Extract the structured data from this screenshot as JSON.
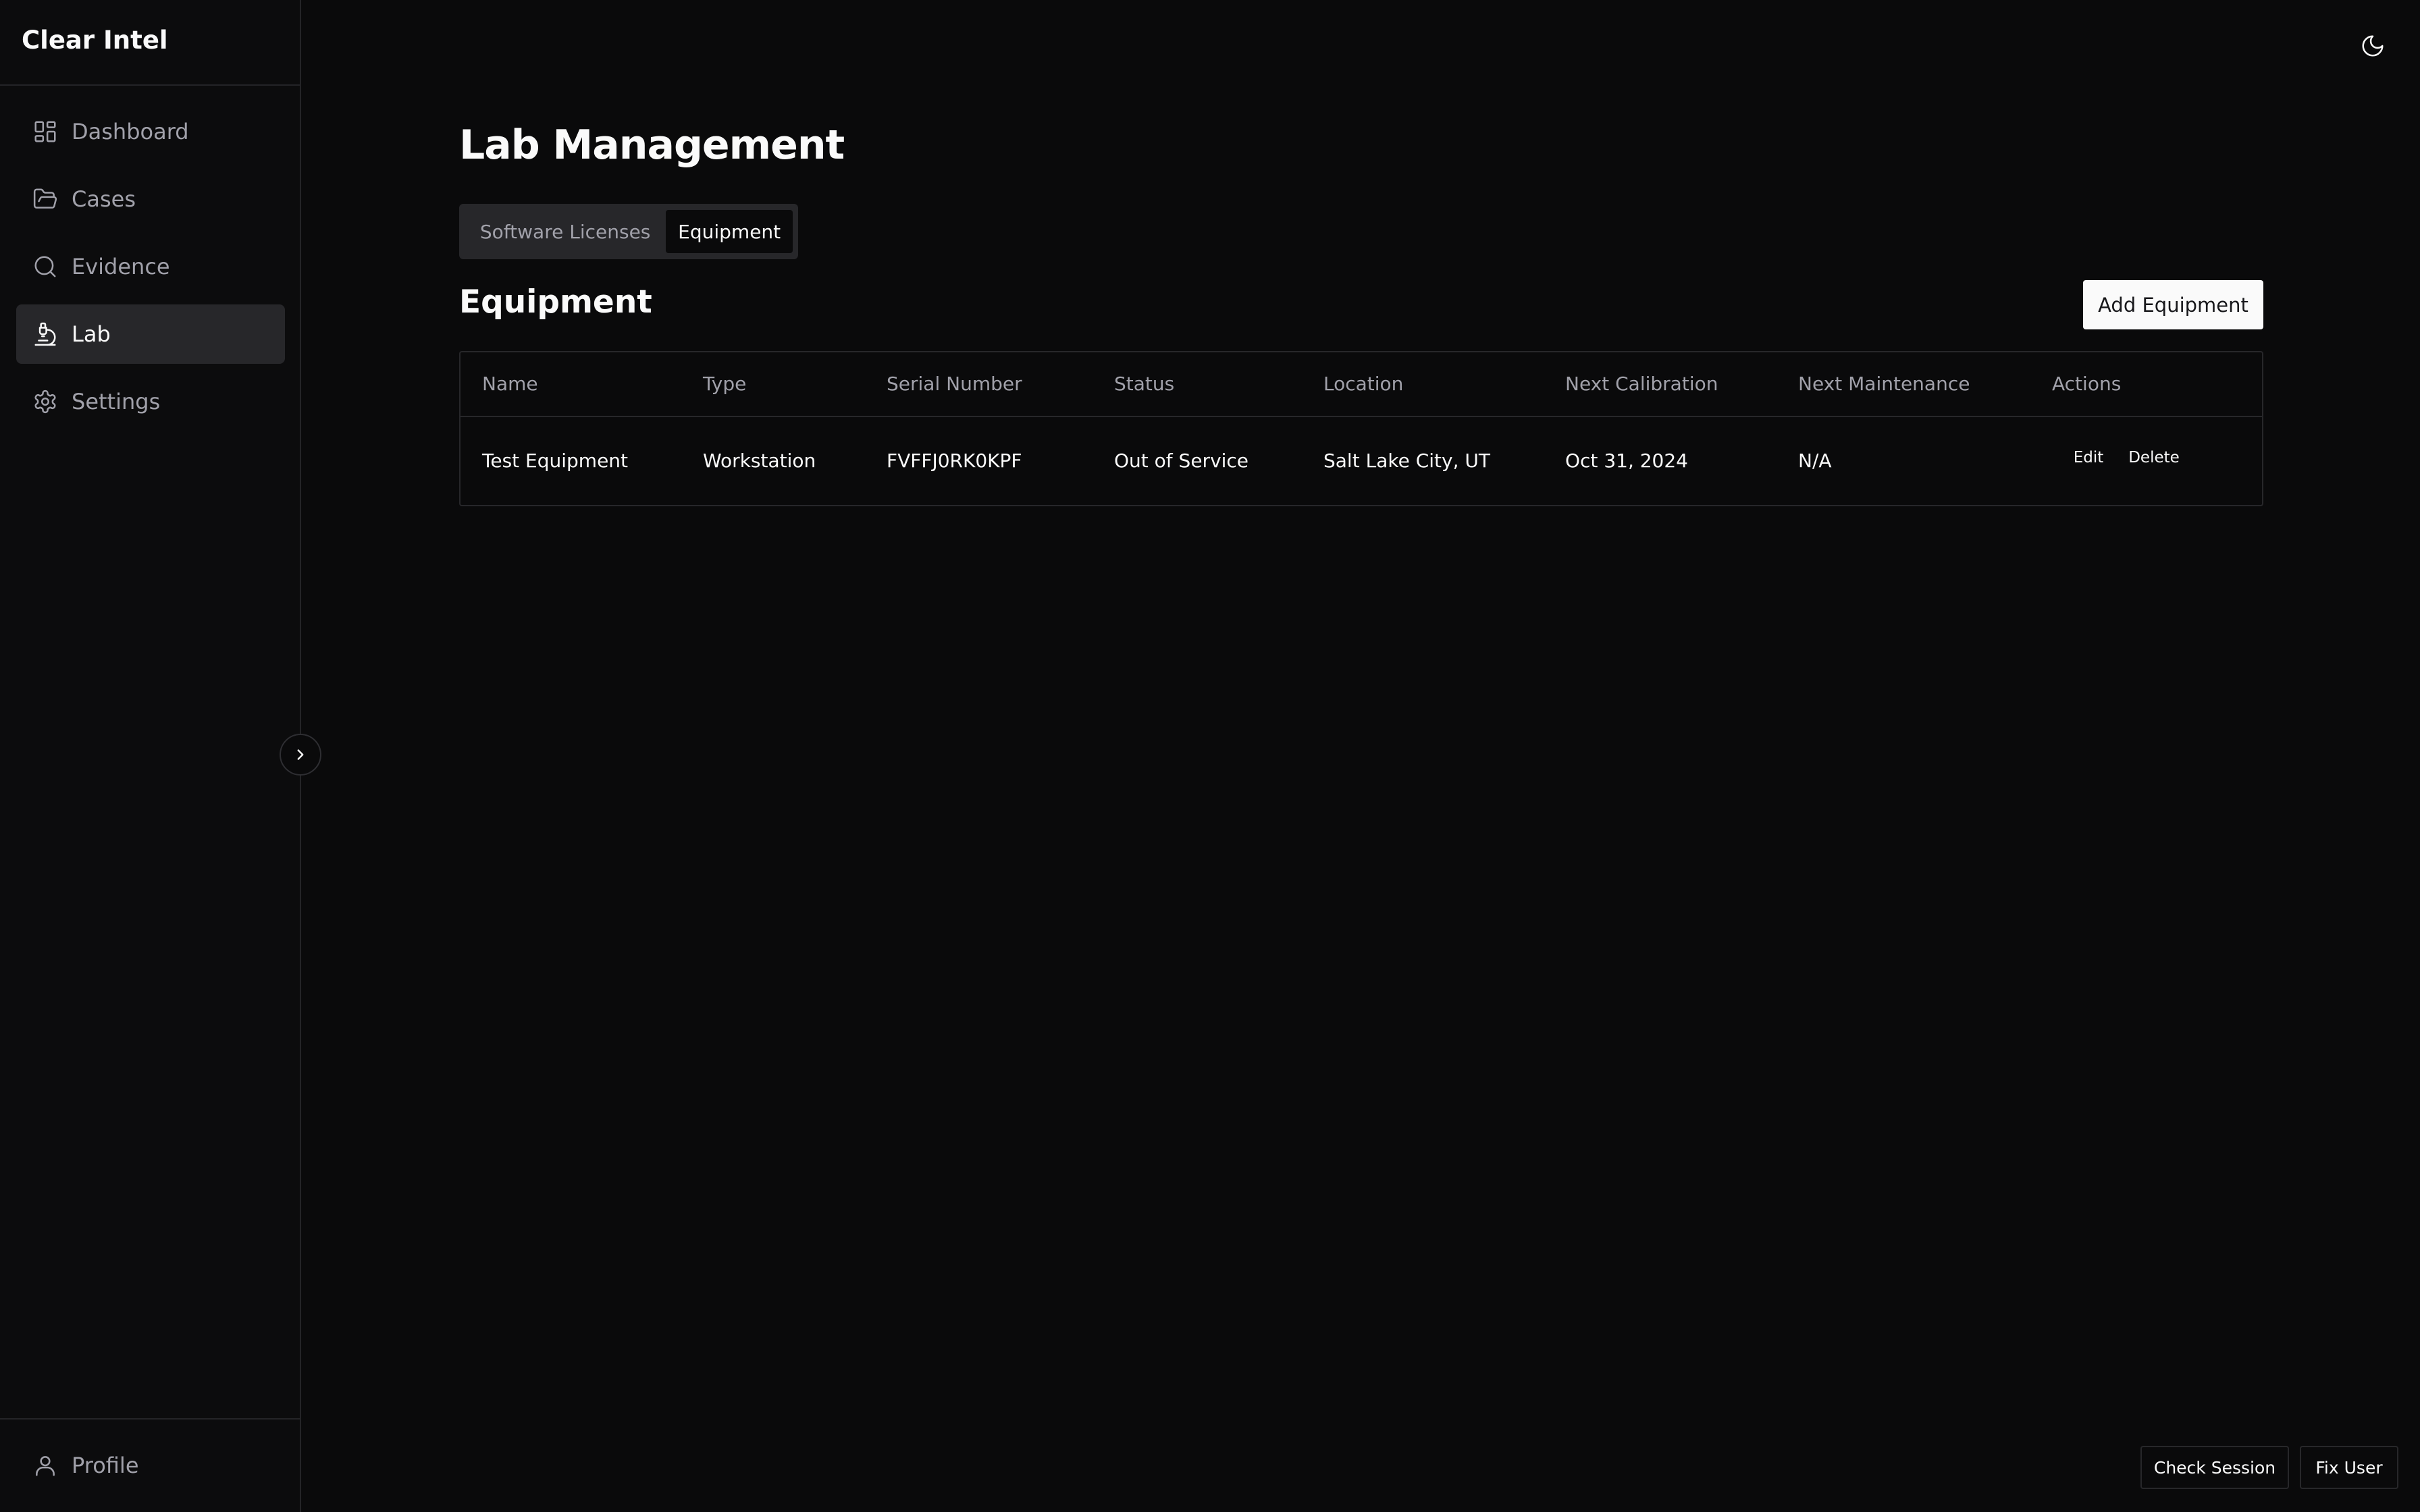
{
  "app": {
    "brand": "Clear Intel"
  },
  "sidebar": {
    "items": [
      {
        "label": "Dashboard",
        "icon": "layout-grid-icon"
      },
      {
        "label": "Cases",
        "icon": "folder-open-icon"
      },
      {
        "label": "Evidence",
        "icon": "search-icon"
      },
      {
        "label": "Lab",
        "icon": "microscope-icon",
        "active": true
      },
      {
        "label": "Settings",
        "icon": "gear-icon"
      }
    ],
    "profile": {
      "label": "Profile",
      "icon": "user-icon"
    }
  },
  "header": {
    "theme_toggle_icon": "moon-icon"
  },
  "main": {
    "title": "Lab Management",
    "tabs": [
      {
        "label": "Software Licenses",
        "active": false
      },
      {
        "label": "Equipment",
        "active": true
      }
    ],
    "section_title": "Equipment",
    "add_button": "Add Equipment",
    "table": {
      "columns": [
        "Name",
        "Type",
        "Serial Number",
        "Status",
        "Location",
        "Next Calibration",
        "Next Maintenance",
        "Actions"
      ],
      "rows": [
        {
          "name": "Test Equipment",
          "type": "Workstation",
          "serial": "FVFFJ0RK0KPF",
          "status": "Out of Service",
          "location": "Salt Lake City, UT",
          "next_calibration": "Oct 31, 2024",
          "next_maintenance": "N/A",
          "actions": [
            "Edit",
            "Delete"
          ]
        }
      ]
    }
  },
  "footer": {
    "check_session": "Check Session",
    "fix_user": "Fix User"
  },
  "colors": {
    "background": "#0a0a0b",
    "sidebar_active": "#27272a",
    "primary_button": "#fafafa",
    "muted_text": "#a1a1aa"
  }
}
